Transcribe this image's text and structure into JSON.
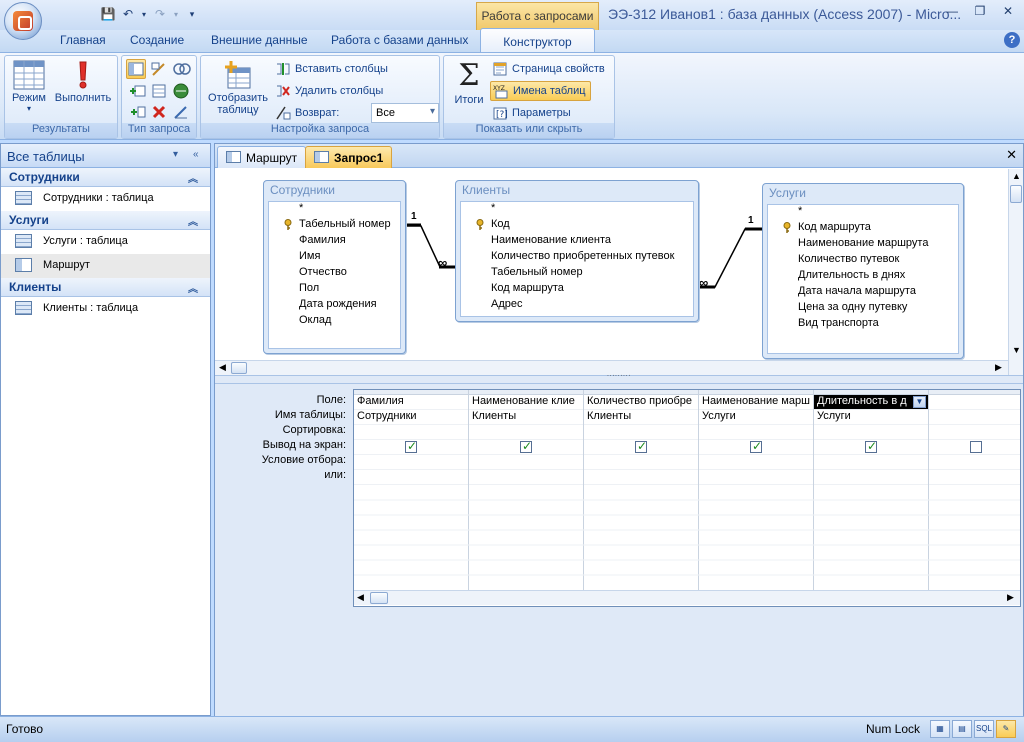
{
  "window": {
    "title": "ЭЭ-312 Иванов1 : база данных (Access 2007) - Micro...",
    "context_tab_title": "Работа с запросами"
  },
  "ribbon": {
    "tabs": [
      "Главная",
      "Создание",
      "Внешние данные",
      "Работа с базами данных",
      "Конструктор"
    ],
    "active_tab": "Конструктор",
    "groups": {
      "results": {
        "label": "Результаты",
        "view": "Режим",
        "run": "Выполнить"
      },
      "query_type": {
        "label": "Тип запроса"
      },
      "query_setup": {
        "label": "Настройка запроса",
        "show_table_line1": "Отобразить",
        "show_table_line2": "таблицу",
        "insert_columns": "Вставить столбцы",
        "delete_columns": "Удалить столбцы",
        "return_label": "Возврат:",
        "return_value": "Все"
      },
      "show_hide": {
        "label": "Показать или скрыть",
        "totals": "Итоги",
        "property_sheet": "Страница свойств",
        "table_names": "Имена таблиц",
        "parameters": "Параметры"
      }
    }
  },
  "nav": {
    "header": "Все таблицы",
    "groups": [
      {
        "name": "Сотрудники",
        "items": [
          {
            "label": "Сотрудники : таблица",
            "kind": "table"
          }
        ]
      },
      {
        "name": "Услуги",
        "items": [
          {
            "label": "Услуги : таблица",
            "kind": "table"
          },
          {
            "label": "Маршрут",
            "kind": "query"
          }
        ]
      },
      {
        "name": "Клиенты",
        "items": [
          {
            "label": "Клиенты : таблица",
            "kind": "table"
          }
        ]
      }
    ]
  },
  "document": {
    "tabs": [
      "Маршрут",
      "Запрос1"
    ],
    "active_tab": "Запрос1",
    "tables": [
      {
        "name": "Сотрудники",
        "fields": [
          "*",
          "Табельный номер",
          "Фамилия",
          "Имя",
          "Отчество",
          "Пол",
          "Дата рождения",
          "Оклад"
        ],
        "key": "Табельный номер"
      },
      {
        "name": "Клиенты",
        "fields": [
          "*",
          "Код",
          "Наименование клиента",
          "Количество приобретенных путевок",
          "Табельный номер",
          "Код маршрута",
          "Адрес"
        ],
        "key": "Код"
      },
      {
        "name": "Услуги",
        "fields": [
          "*",
          "Код маршрута",
          "Наименование маршрута",
          "Количество путевок",
          "Длительность в днях",
          "Дата начала маршрута",
          "Цена за одну путевку",
          "Вид транспорта"
        ],
        "key": "Код маршрута"
      }
    ],
    "relations": [
      {
        "one": "1",
        "many": "∞"
      },
      {
        "one": "1",
        "many": "∞"
      }
    ],
    "grid_row_labels": [
      "Поле:",
      "Имя таблицы:",
      "Сортировка:",
      "Вывод на экран:",
      "Условие отбора:",
      "или:"
    ],
    "grid_columns": [
      {
        "field": "Фамилия",
        "table": "Сотрудники",
        "show": true
      },
      {
        "field": "Наименование клие",
        "table": "Клиенты",
        "show": true
      },
      {
        "field": "Количество приобре",
        "table": "Клиенты",
        "show": true
      },
      {
        "field": "Наименование марш",
        "table": "Услуги",
        "show": true
      },
      {
        "field": "Длительность в д",
        "table": "Услуги",
        "show": true,
        "selected": true
      },
      {
        "field": "",
        "table": "",
        "show": false
      }
    ]
  },
  "status": {
    "left": "Готово",
    "num_lock": "Num Lock",
    "view_buttons": [
      "datasheet-view",
      "pivot-table-view",
      "sql-view",
      "design-view"
    ],
    "sql_label": "SQL"
  },
  "colors": {
    "accent": "#15428b",
    "ribbon_bg": "#dbe8f9",
    "active_tab": "#f8c95b",
    "selection": "#000000"
  }
}
